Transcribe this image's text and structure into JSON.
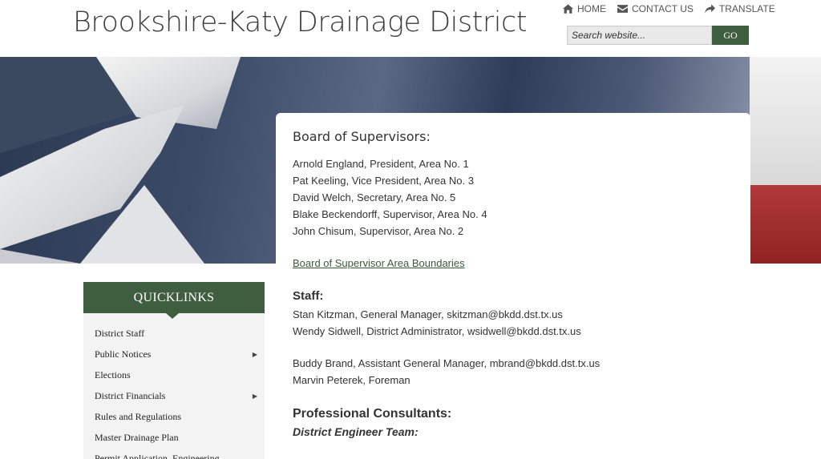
{
  "header": {
    "site_title": "Brookshire-Katy Drainage District",
    "nav": [
      {
        "label": "HOME",
        "icon": "home-icon"
      },
      {
        "label": "CONTACT US",
        "icon": "envelope-icon"
      },
      {
        "label": "TRANSLATE",
        "icon": "share-arrow-icon"
      }
    ],
    "search": {
      "placeholder": "Search website...",
      "button_label": "GO"
    }
  },
  "colors": {
    "accent_green": "#3f5d3f",
    "link_green": "#3b5a3b"
  },
  "board": {
    "title": "Board of Supervisors:",
    "members": [
      "Arnold England, President, Area No. 1",
      "Pat Keeling, Vice President, Area No. 3",
      "David Welch, Secretary, Area No. 5",
      "Blake Beckendorff, Supervisor, Area No. 4",
      "John Chisum, Supervisor, Area No. 2"
    ],
    "boundaries_link": "Board of Supervisor Area Boundaries"
  },
  "staff": {
    "title": "Staff:",
    "group1": [
      "Stan Kitzman, General Manager, skitzman@bkdd.dst.tx.us",
      "Wendy Sidwell, District Administrator, wsidwell@bkdd.dst.tx.us"
    ],
    "group2": [
      "Buddy Brand, Assistant General Manager, mbrand@bkdd.dst.tx.us",
      "Marvin Peterek, Foreman"
    ]
  },
  "consultants": {
    "title": "Professional Consultants:",
    "subtitle": "District Engineer Team:"
  },
  "quicklinks": {
    "title": "QUICKLINKS",
    "items": [
      {
        "label": "District Staff",
        "has_submenu": false
      },
      {
        "label": "Public Notices",
        "has_submenu": true
      },
      {
        "label": "Elections",
        "has_submenu": false
      },
      {
        "label": "District Financials",
        "has_submenu": true
      },
      {
        "label": "Rules and Regulations",
        "has_submenu": false
      },
      {
        "label": "Master Drainage Plan",
        "has_submenu": false
      },
      {
        "label": "Permit Application, Engineering",
        "has_submenu": false
      }
    ]
  }
}
